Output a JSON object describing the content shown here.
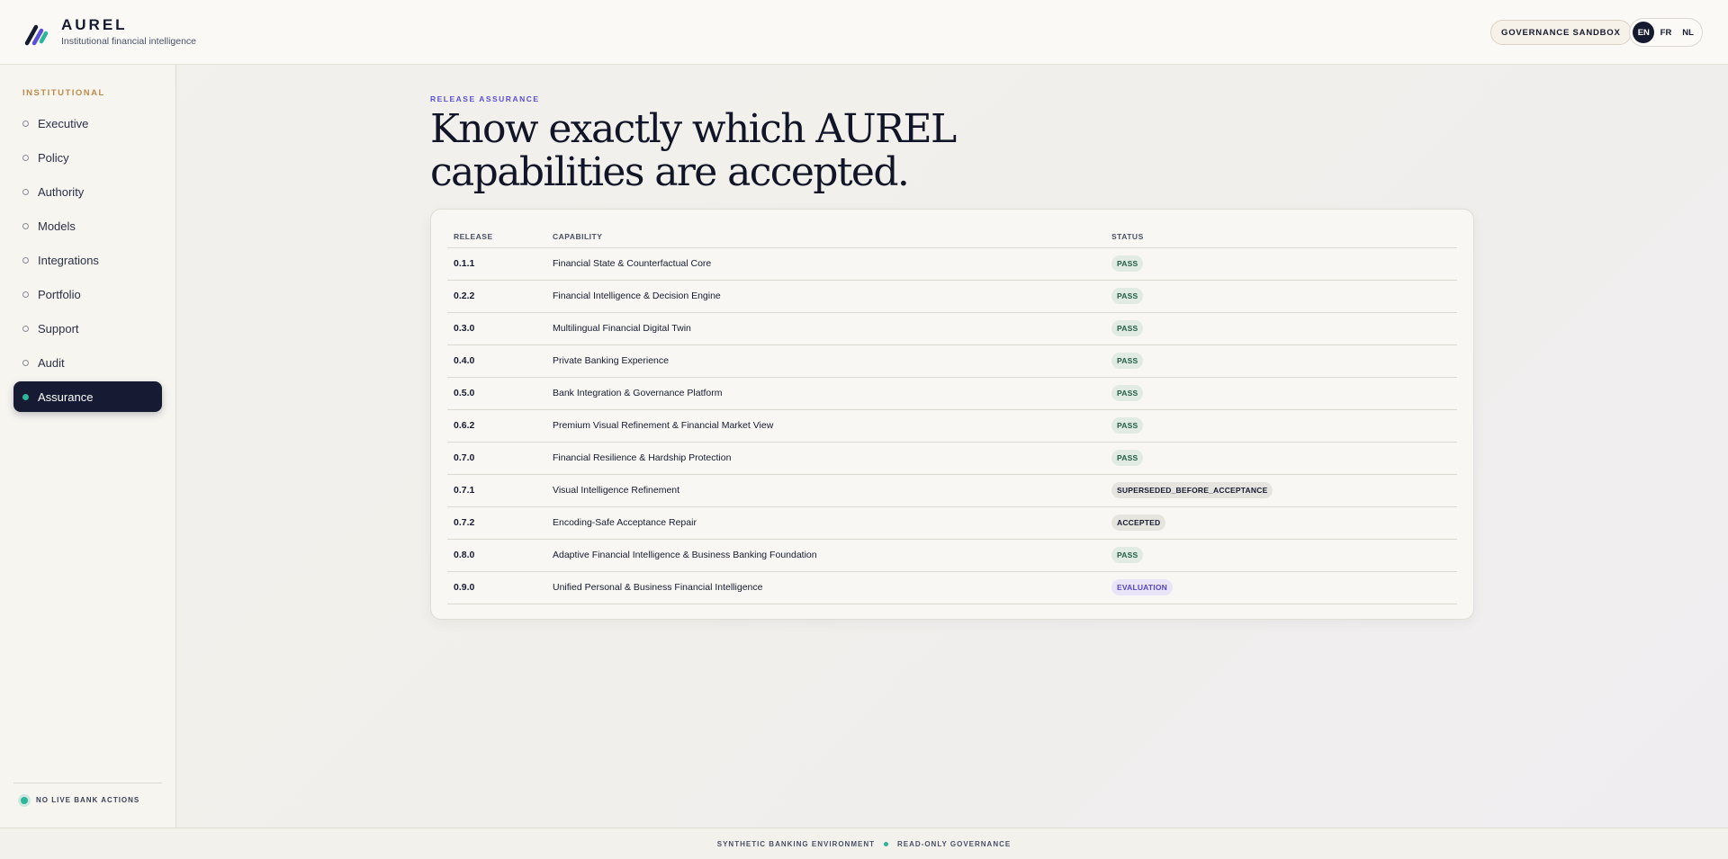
{
  "brand": {
    "name": "AUREL",
    "tagline": "Institutional financial intelligence",
    "logo_icon": "aurel-slash-logo-icon"
  },
  "header": {
    "sandbox_label": "GOVERNANCE SANDBOX",
    "languages": [
      {
        "code": "EN",
        "active": true
      },
      {
        "code": "FR",
        "active": false
      },
      {
        "code": "NL",
        "active": false
      }
    ]
  },
  "sidebar": {
    "section": "INSTITUTIONAL",
    "items": [
      {
        "label": "Executive",
        "active": false
      },
      {
        "label": "Policy",
        "active": false
      },
      {
        "label": "Authority",
        "active": false
      },
      {
        "label": "Models",
        "active": false
      },
      {
        "label": "Integrations",
        "active": false
      },
      {
        "label": "Portfolio",
        "active": false
      },
      {
        "label": "Support",
        "active": false
      },
      {
        "label": "Audit",
        "active": false
      },
      {
        "label": "Assurance",
        "active": true
      }
    ],
    "footer_status": "NO LIVE BANK ACTIONS"
  },
  "main": {
    "eyebrow": "RELEASE ASSURANCE",
    "title_line1": "Know exactly which AUREL",
    "title_line2": "capabilities are accepted.",
    "table": {
      "headers": {
        "release": "RELEASE",
        "capability": "CAPABILITY",
        "status": "STATUS"
      },
      "rows": [
        {
          "release": "0.1.1",
          "capability": "Financial State & Counterfactual Core",
          "status": "PASS"
        },
        {
          "release": "0.2.2",
          "capability": "Financial Intelligence & Decision Engine",
          "status": "PASS"
        },
        {
          "release": "0.3.0",
          "capability": "Multilingual Financial Digital Twin",
          "status": "PASS"
        },
        {
          "release": "0.4.0",
          "capability": "Private Banking Experience",
          "status": "PASS"
        },
        {
          "release": "0.5.0",
          "capability": "Bank Integration & Governance Platform",
          "status": "PASS"
        },
        {
          "release": "0.6.2",
          "capability": "Premium Visual Refinement & Financial Market View",
          "status": "PASS"
        },
        {
          "release": "0.7.0",
          "capability": "Financial Resilience & Hardship Protection",
          "status": "PASS"
        },
        {
          "release": "0.7.1",
          "capability": "Visual Intelligence Refinement",
          "status": "SUPERSEDED_BEFORE_ACCEPTANCE"
        },
        {
          "release": "0.7.2",
          "capability": "Encoding-Safe Acceptance Repair",
          "status": "ACCEPTED"
        },
        {
          "release": "0.8.0",
          "capability": "Adaptive Financial Intelligence & Business Banking Foundation",
          "status": "PASS"
        },
        {
          "release": "0.9.0",
          "capability": "Unified Personal & Business Financial Intelligence",
          "status": "EVALUATION"
        }
      ]
    }
  },
  "footer": {
    "left": "SYNTHETIC BANKING ENVIRONMENT",
    "right": "READ-ONLY GOVERNANCE"
  },
  "colors": {
    "accent": "#5a4fd6",
    "nav_active": "#161b33",
    "success": "#2bb59a",
    "gold": "#c08a4a"
  }
}
